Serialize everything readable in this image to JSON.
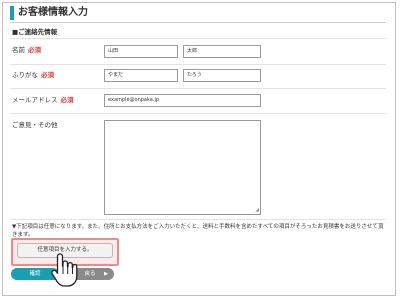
{
  "header": {
    "title": "お客様情報入力"
  },
  "section": {
    "label": "■ご連絡先情報"
  },
  "form": {
    "required_mark": "必須",
    "name": {
      "label": "名前",
      "last": "山田",
      "first": "太郎"
    },
    "furigana": {
      "label": "ふりがな",
      "last": "やまだ",
      "first": "たろう"
    },
    "email": {
      "label": "メールアドレス",
      "value": "example@onpaka.jp"
    },
    "comment": {
      "label": "ご意見・その他",
      "value": ""
    }
  },
  "note": "▼下記項目は任意になります。また、住所とお支払方法をご入力いただくと、送料と手数料を含めたすべての項目がそろったお見積書をお送りさせて頂きます。",
  "buttons": {
    "fill_optional": "任意項目を入力する。",
    "confirm": "確認",
    "back": "戻る"
  },
  "colors": {
    "accent": "#1a9fb0",
    "required": "#e53c3c",
    "highlight": "#e98b8b"
  }
}
